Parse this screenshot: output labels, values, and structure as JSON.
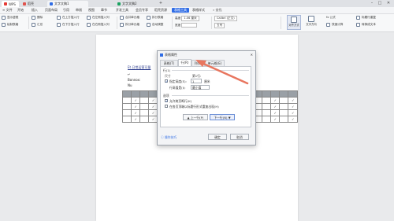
{
  "title_bar": {
    "tabs": [
      {
        "label": "WPS",
        "color": "#e53935"
      },
      {
        "label": "稻壳",
        "color": "#e0524c"
      },
      {
        "label": "文字文稿1",
        "color": "#2f6ce5"
      },
      {
        "label": "文字文稿2",
        "color": "#1aa260"
      }
    ],
    "add_tab": "+",
    "win_min": "–",
    "win_max": "□",
    "win_close": "✕"
  },
  "menu": {
    "items": [
      "≡ 文件",
      "开始",
      "插入",
      "页面布局",
      "引用",
      "审阅",
      "视图",
      "章节",
      "开发工具",
      "会员专享",
      "稻壳资源",
      "表格工具",
      "表格样式"
    ],
    "active_index": 11,
    "search": "查找"
  },
  "ribbon": {
    "groups": [
      [
        "显示虚框",
        "绘制表格"
      ],
      [
        "删除",
        "汇总"
      ],
      [
        "在上方插入行",
        "在下方插入行"
      ],
      [
        "在左侧插入列",
        "在右侧插入列"
      ],
      [
        "合并单元格",
        "拆分单元格"
      ],
      [
        "拆分表格",
        "自动调整"
      ],
      [
        "高度",
        "宽度"
      ],
      [
        "Calibri (正文)",
        "五号"
      ],
      [
        "对齐方式",
        "文字方向"
      ],
      [
        "fx 公式",
        "快速计算"
      ],
      [
        "标题行重复",
        "转换成文本"
      ]
    ],
    "height_value": "1.06 厘米"
  },
  "document": {
    "line1": "Et.日常运营可量",
    "line2": "Bonnox:",
    "line3": "Nu",
    "cell_mark": "✓",
    "header_marks": [
      "—",
      "+",
      "+",
      "+",
      "✓",
      "✓"
    ]
  },
  "dialog": {
    "title": "表格属性",
    "tabs": [
      "表格(T)",
      "行(R)",
      "列(U)",
      "单元格(E)"
    ],
    "selected_tab": 1,
    "section_row": "行(1)",
    "size_label": "尺寸",
    "row_label": "第1行:",
    "specify_height": "指定高度(S):",
    "height_value": "1",
    "height_unit": "厘米",
    "row_height_is": "行高值是(I):",
    "row_height_mode": "最小值",
    "options_label": "选项",
    "allow_break": "允许跨页断行(K)",
    "repeat_header": "在各页顶端以标题行形式重复出现(H)",
    "prev_row": "▲ 上一行(P)",
    "next_row": "下一行(N) ▼",
    "tips": "操作技巧",
    "ok": "确定",
    "cancel": "取消"
  },
  "colors": {
    "accent": "#2f6ce5",
    "arrow": "#e8765f"
  }
}
